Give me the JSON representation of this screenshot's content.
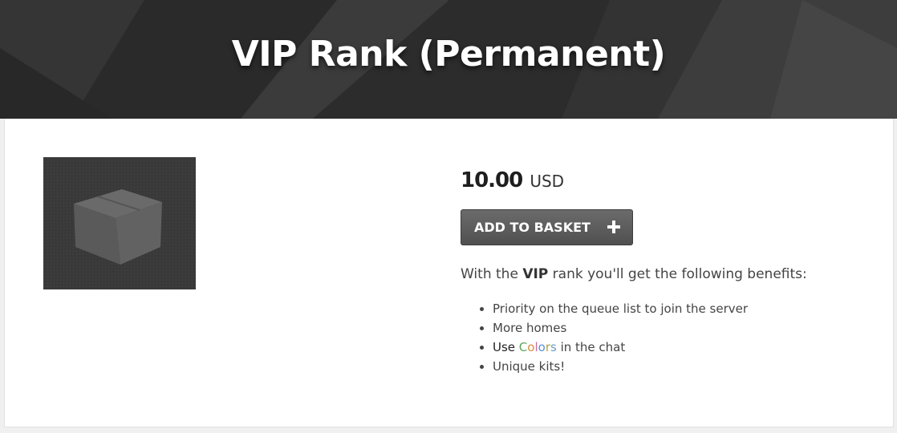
{
  "hero": {
    "title": "VIP Rank (Permanent)"
  },
  "product": {
    "image_icon": "cardboard-box-icon",
    "price_amount": "10.00",
    "price_currency": "USD",
    "add_button_label": "ADD TO BASKET",
    "add_button_icon": "plus-icon",
    "description": {
      "prefix": "With the ",
      "rank": "VIP",
      "suffix": " rank you'll get the following benefits:"
    },
    "benefits": [
      {
        "text": "Priority on the queue list to join the server"
      },
      {
        "text": "More homes"
      },
      {
        "prefix": "Use ",
        "colored": [
          "C",
          "o",
          "l",
          "o",
          "r",
          "s"
        ],
        "suffix": " in the chat"
      },
      {
        "text": "Unique kits!"
      }
    ]
  },
  "colors": {
    "hero_bg": "#2e2e2e",
    "button_bg": "#5c5c5c",
    "card_bg": "#ffffff",
    "page_bg": "#f0f0f0"
  }
}
